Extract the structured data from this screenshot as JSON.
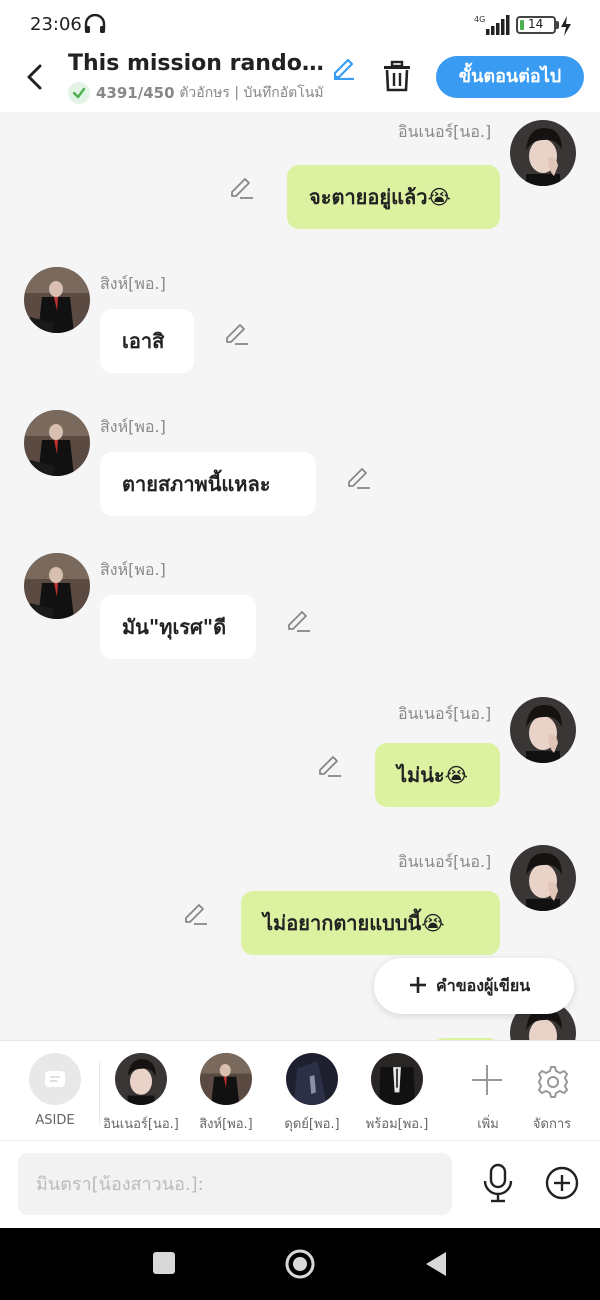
{
  "status_bar": {
    "time": "23:06",
    "network": "4G",
    "battery": "14",
    "battery_level": 0.14
  },
  "header": {
    "title": "This mission randomly",
    "word_count": "4391/450",
    "meta": "ตัวอักษร | บันทึกอัตโนมั",
    "next_button": "ขั้นตอนต่อไป"
  },
  "messages": [
    {
      "side": "right",
      "name": "อินเนอร์[นอ.]",
      "text": "จะตายอยู่แล้ว😭",
      "avatar": "avatar-inner"
    },
    {
      "side": "left",
      "name": "สิงห์[พอ.]",
      "text": "เอาสิ",
      "avatar": "avatar-singh"
    },
    {
      "side": "left",
      "name": "สิงห์[พอ.]",
      "text": "ตายสภาพนี้แหละ",
      "avatar": "avatar-singh"
    },
    {
      "side": "left",
      "name": "สิงห์[พอ.]",
      "text": "มัน\"ทุเรศ\"ดี",
      "avatar": "avatar-singh"
    },
    {
      "side": "right",
      "name": "อินเนอร์[นอ.]",
      "text": "ไม่น่ะ😭",
      "avatar": "avatar-inner"
    },
    {
      "side": "right",
      "name": "อินเนอร์[นอ.]",
      "text": "ไม่อยากตายแบบนี้😭",
      "avatar": "avatar-inner"
    }
  ],
  "fab": {
    "label": "คำของผู้เขียน"
  },
  "character_bar": {
    "aside": "ASIDE",
    "characters": [
      {
        "label": "อินเนอร์[นอ.]"
      },
      {
        "label": "สิงห์[พอ.]"
      },
      {
        "label": "ดุดย์[พอ.]"
      },
      {
        "label": "พร้อม[พอ.]"
      }
    ],
    "add_label": "เพิ่ม",
    "manage_label": "จัดการ"
  },
  "composer": {
    "placeholder": "มินตรา[น้องสาวนอ.]:"
  },
  "colors": {
    "accent": "#3a9bf2",
    "bubble_right": "#dcf2a1",
    "bubble_left": "#ffffff",
    "background": "#f5f5f5"
  }
}
